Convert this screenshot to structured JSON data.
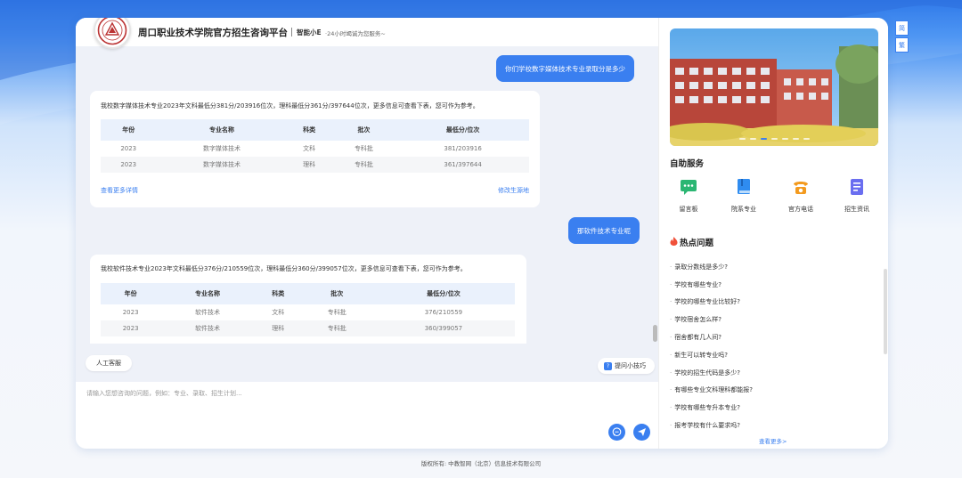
{
  "header": {
    "title": "周口职业技术学院官方招生咨询平台",
    "brand": "智能小E",
    "tagline": "·24小时竭诚为您服务~"
  },
  "chat": {
    "messages": [
      {
        "role": "user",
        "text": "你们学校数字媒体技术专业录取分是多少"
      },
      {
        "role": "bot",
        "text": "我校数字媒体技术专业2023年文科最低分381分/203916位次，理科最低分361分/397644位次，更多信息可查看下表，您可作为参考。",
        "table": {
          "headers": [
            "年份",
            "专业名称",
            "科类",
            "批次",
            "最低分/位次"
          ],
          "rows": [
            [
              "2023",
              "数字媒体技术",
              "文科",
              "专科批",
              "381/203916"
            ],
            [
              "2023",
              "数字媒体技术",
              "理科",
              "专科批",
              "361/397644"
            ]
          ]
        },
        "more_link": "查看更多详情",
        "change_link": "修改生源地"
      },
      {
        "role": "user",
        "text": "那软件技术专业呢"
      },
      {
        "role": "bot",
        "text": "我校软件技术专业2023年文科最低分376分/210559位次，理科最低分360分/399057位次，更多信息可查看下表，您可作为参考。",
        "table": {
          "headers": [
            "年份",
            "专业名称",
            "科类",
            "批次",
            "最低分/位次"
          ],
          "rows": [
            [
              "2023",
              "软件技术",
              "文科",
              "专科批",
              "376/210559"
            ],
            [
              "2023",
              "软件技术",
              "理科",
              "专科批",
              "360/399057"
            ]
          ]
        }
      }
    ],
    "human_service": "人工客服",
    "tips": "提问小技巧",
    "input_placeholder": "请输入您想咨询的问题，例如：专业、录取、招生计划..."
  },
  "sidebar": {
    "self_service_title": "自助服务",
    "services": [
      {
        "label": "留言板",
        "icon": "message-board-icon",
        "color": "#2bb673"
      },
      {
        "label": "院系专业",
        "icon": "book-icon",
        "color": "#2f8cf0"
      },
      {
        "label": "官方电话",
        "icon": "telephone-icon",
        "color": "#f39a1e"
      },
      {
        "label": "招生资讯",
        "icon": "document-icon",
        "color": "#6a6ef0"
      }
    ],
    "hot_title": "热点问题",
    "hot_questions": [
      "录取分数线是多少?",
      "学校有哪些专业?",
      "学校的哪些专业比较好?",
      "学校宿舍怎么样?",
      "宿舍都有几人间?",
      "新生可以转专业吗?",
      "学校的招生代码是多少?",
      "有哪些专业文科理科都能报?",
      "学校有哪些专升本专业?",
      "报考学校有什么要求吗?"
    ],
    "more": "查看更多>"
  },
  "lang": {
    "simplified": "简",
    "traditional": "繁"
  },
  "footer": "版权所有: 中教智网（北京）信息技术有限公司",
  "colors": {
    "accent": "#3a7ff0",
    "hot": "#f0513a"
  }
}
